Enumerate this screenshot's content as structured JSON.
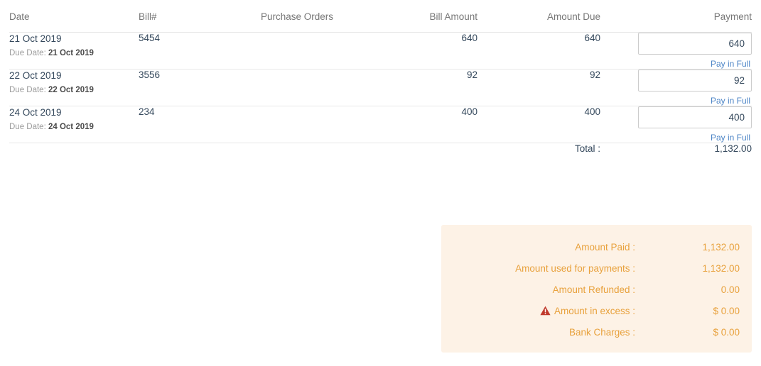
{
  "table": {
    "headers": {
      "date": "Date",
      "bill_no": "Bill#",
      "purchase_orders": "Purchase Orders",
      "bill_amount": "Bill Amount",
      "amount_due": "Amount Due",
      "payment": "Payment"
    },
    "due_date_prefix": "Due Date:",
    "pay_in_full_label": "Pay in Full",
    "rows": [
      {
        "date": "21 Oct 2019",
        "due_date": "21 Oct 2019",
        "bill_no": "5454",
        "purchase_orders": "",
        "bill_amount": "640",
        "amount_due": "640",
        "payment_value": "640"
      },
      {
        "date": "22 Oct 2019",
        "due_date": "22 Oct 2019",
        "bill_no": "3556",
        "purchase_orders": "",
        "bill_amount": "92",
        "amount_due": "92",
        "payment_value": "92"
      },
      {
        "date": "24 Oct 2019",
        "due_date": "24 Oct 2019",
        "bill_no": "234",
        "purchase_orders": "",
        "bill_amount": "400",
        "amount_due": "400",
        "payment_value": "400"
      }
    ],
    "total_label": "Total :",
    "total_value": "1,132.00"
  },
  "summary": {
    "rows": [
      {
        "label": "Amount Paid :",
        "value": "1,132.00",
        "icon": ""
      },
      {
        "label": "Amount used for payments :",
        "value": "1,132.00",
        "icon": ""
      },
      {
        "label": "Amount Refunded :",
        "value": "0.00",
        "icon": ""
      },
      {
        "label": "Amount in excess :",
        "value": "$ 0.00",
        "icon": "warning-triangle-icon"
      },
      {
        "label": "Bank Charges :",
        "value": "$ 0.00",
        "icon": ""
      }
    ]
  },
  "colors": {
    "accent_orange": "#e8a13c",
    "panel_background": "#fdf2e6",
    "link_blue": "#4d85c6",
    "warning_red": "#c0392b",
    "text_primary": "#33475b",
    "header_gray": "#767676"
  }
}
